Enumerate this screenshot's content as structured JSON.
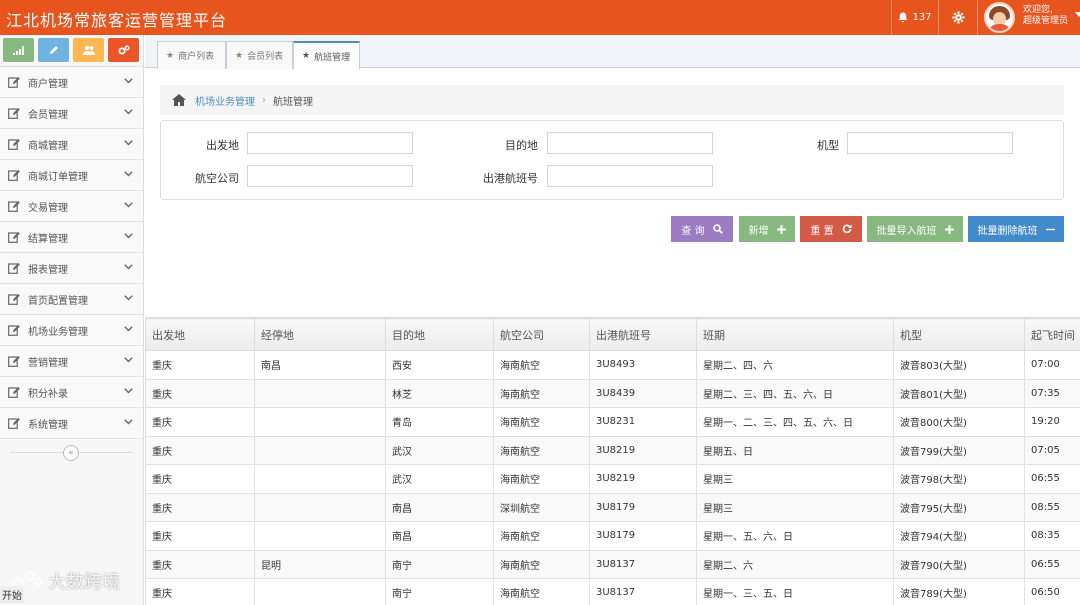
{
  "header": {
    "title": "江北机场常旅客运营管理平台",
    "notification_count": "137",
    "welcome_line1": "欢迎您,",
    "welcome_line2": "超级管理员"
  },
  "colors": {
    "brand": "#e8541e",
    "btn_query": "#9c7dc4",
    "btn_add": "#87b87f",
    "btn_reset": "#d15b47",
    "btn_import": "#87b87f",
    "btn_delete": "#428bca"
  },
  "sidebar": {
    "shortcuts": [
      {
        "icon": "signal-icon",
        "color": "#87b87f"
      },
      {
        "icon": "pencil-icon",
        "color": "#6fb3e0"
      },
      {
        "icon": "users-icon",
        "color": "#ffb752"
      },
      {
        "icon": "cogs-icon",
        "color": "#e8562a"
      }
    ],
    "items": [
      {
        "label": "商户管理",
        "icon": "edit-icon"
      },
      {
        "label": "会员管理",
        "icon": "edit-icon"
      },
      {
        "label": "商城管理",
        "icon": "edit-icon"
      },
      {
        "label": "商城订单管理",
        "icon": "edit-icon"
      },
      {
        "label": "交易管理",
        "icon": "edit-icon"
      },
      {
        "label": "结算管理",
        "icon": "edit-icon"
      },
      {
        "label": "报表管理",
        "icon": "edit-icon"
      },
      {
        "label": "首页配置管理",
        "icon": "edit-icon"
      },
      {
        "label": "机场业务管理",
        "icon": "edit-icon"
      },
      {
        "label": "营销管理",
        "icon": "edit-icon"
      },
      {
        "label": "积分补录",
        "icon": "edit-icon"
      },
      {
        "label": "系统管理",
        "icon": "edit-icon"
      }
    ],
    "collapse_glyph": "«"
  },
  "tabs": [
    {
      "label": "商户列表"
    },
    {
      "label": "会员列表"
    },
    {
      "label": "航班管理"
    }
  ],
  "breadcrumb": {
    "parent": "机场业务管理",
    "current": "航班管理"
  },
  "filters": {
    "departure_label": "出发地",
    "destination_label": "目的地",
    "aircraft_label": "机型",
    "airline_label": "航空公司",
    "flight_no_label": "出港航班号"
  },
  "actions": {
    "query": "查 询",
    "add": "新增",
    "reset": "重 置",
    "import": "批量导入航班",
    "delete": "批量删除航班"
  },
  "table": {
    "headers": [
      "出发地",
      "经停地",
      "目的地",
      "航空公司",
      "出港航班号",
      "班期",
      "机型",
      "起飞时间"
    ],
    "rows": [
      [
        "重庆",
        "南昌",
        "西安",
        "海南航空",
        "3U8493",
        "星期二、四、六",
        "波音803(大型)",
        "07:00"
      ],
      [
        "重庆",
        "",
        "林芝",
        "海南航空",
        "3U8439",
        "星期二、三、四、五、六、日",
        "波音801(大型)",
        "07:35"
      ],
      [
        "重庆",
        "",
        "青岛",
        "海南航空",
        "3U8231",
        "星期一、二、三、四、五、六、日",
        "波音800(大型)",
        "19:20"
      ],
      [
        "重庆",
        "",
        "武汉",
        "海南航空",
        "3U8219",
        "星期五、日",
        "波音799(大型)",
        "07:05"
      ],
      [
        "重庆",
        "",
        "武汉",
        "海南航空",
        "3U8219",
        "星期三",
        "波音798(大型)",
        "06:55"
      ],
      [
        "重庆",
        "",
        "南昌",
        "深圳航空",
        "3U8179",
        "星期三",
        "波音795(大型)",
        "08:55"
      ],
      [
        "重庆",
        "",
        "南昌",
        "海南航空",
        "3U8179",
        "星期一、五、六、日",
        "波音794(大型)",
        "08:35"
      ],
      [
        "重庆",
        "昆明",
        "南宁",
        "海南航空",
        "3U8137",
        "星期二、六",
        "波音790(大型)",
        "06:55"
      ],
      [
        "重庆",
        "",
        "南宁",
        "海南航空",
        "3U8137",
        "星期一、三、五、日",
        "波音789(大型)",
        "06:50"
      ]
    ]
  },
  "watermark": "大数跨境",
  "taskbar_start": "开始"
}
